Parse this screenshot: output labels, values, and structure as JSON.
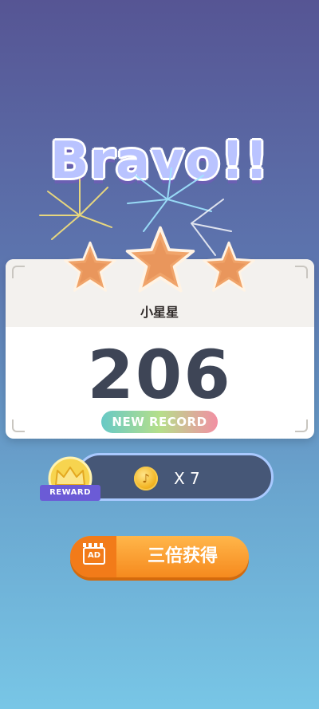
{
  "title": "Bravo!!",
  "stars": {
    "earned": 3,
    "total": 3,
    "name": "小星星"
  },
  "score": "206",
  "record_badge": "NEW RECORD",
  "reward": {
    "badge_label": "REWARD",
    "coin_icon": "music-note-coin-icon",
    "multiplier": "X 7"
  },
  "ad_button": {
    "icon_label": "AD",
    "label": "三倍获得"
  },
  "colors": {
    "title_fill": "#b9c3ff",
    "star": "#f0a46a",
    "score": "#3e4556",
    "reward_bar": "#465777",
    "ad_button": "#f68a1e"
  }
}
